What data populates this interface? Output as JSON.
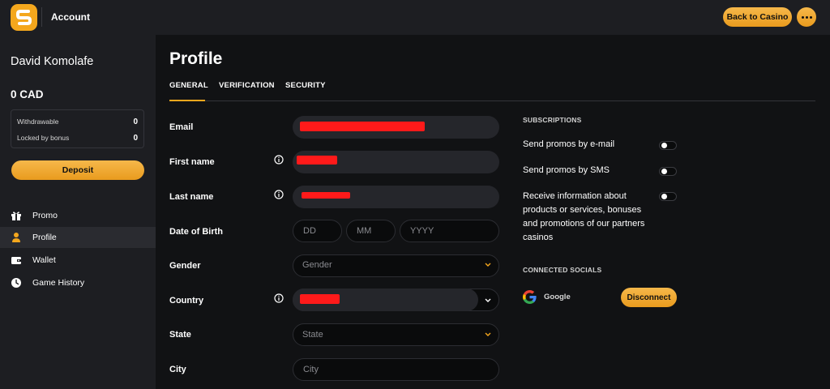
{
  "header": {
    "title": "Account",
    "back_label": "Back to Casino",
    "logo_icon": "s-logo-icon",
    "menu_icon": "more-dots-icon"
  },
  "sidebar": {
    "user_name": "David Komolafe",
    "balance": "0 CAD",
    "withdrawable_label": "Withdrawable",
    "withdrawable_value": "0",
    "locked_label": "Locked by bonus",
    "locked_value": "0",
    "deposit_label": "Deposit",
    "items": [
      {
        "label": "Promo",
        "icon": "gift-icon",
        "active": false
      },
      {
        "label": "Profile",
        "icon": "user-icon",
        "active": true
      },
      {
        "label": "Wallet",
        "icon": "wallet-icon",
        "active": false
      },
      {
        "label": "Game History",
        "icon": "clock-icon",
        "active": false
      }
    ]
  },
  "main": {
    "title": "Profile",
    "tabs": [
      {
        "label": "GENERAL",
        "active": true
      },
      {
        "label": "VERIFICATION",
        "active": false
      },
      {
        "label": "SECURITY",
        "active": false
      }
    ],
    "fields": {
      "email_label": "Email",
      "first_name_label": "First name",
      "last_name_label": "Last name",
      "dob_label": "Date of Birth",
      "dob_day_placeholder": "DD",
      "dob_month_placeholder": "MM",
      "dob_year_placeholder": "YYYY",
      "gender_label": "Gender",
      "gender_placeholder": "Gender",
      "country_label": "Country",
      "state_label": "State",
      "state_placeholder": "State",
      "city_label": "City",
      "city_placeholder": "City"
    }
  },
  "right": {
    "subscriptions_title": "SUBSCRIPTIONS",
    "sub_email": "Send promos by e-mail",
    "sub_sms": "Send promos by SMS",
    "sub_partners": "Receive information about products or services, bonuses and promotions of our partners casinos",
    "connected_title": "CONNECTED SOCIALS",
    "google_label": "Google",
    "disconnect_label": "Disconnect"
  },
  "colors": {
    "accent": "#f4a71d",
    "background": "#111214",
    "panel": "#1d1e22",
    "redaction": "#ff1a1a"
  }
}
